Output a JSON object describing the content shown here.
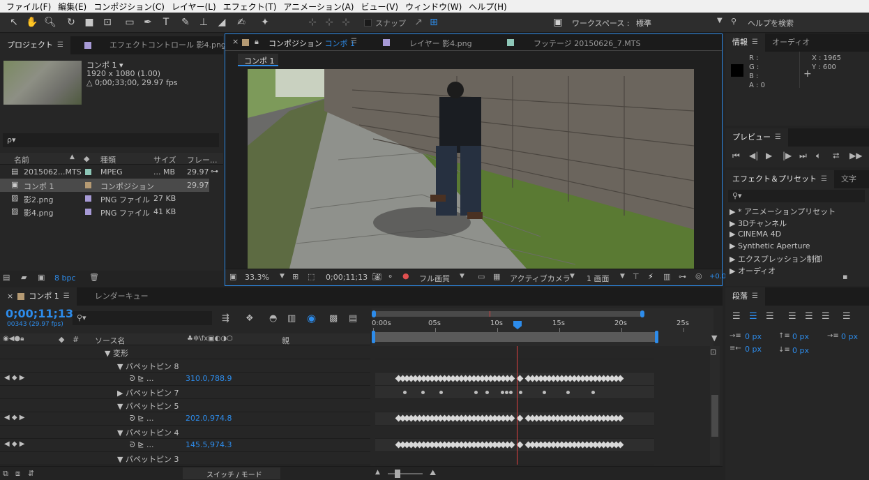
{
  "menu": [
    "ファイル(F)",
    "編集(E)",
    "コンポジション(C)",
    "レイヤー(L)",
    "エフェクト(T)",
    "アニメーション(A)",
    "ビュー(V)",
    "ウィンドウ(W)",
    "ヘルプ(H)"
  ],
  "toolbar": {
    "snap": "スナップ",
    "workspace_label": "ワークスペース :",
    "workspace_value": "標準",
    "help_placeholder": "ヘルプを検索"
  },
  "project": {
    "tab": "プロジェクト",
    "tab2": "エフェクトコントロール 影4.png",
    "comp_name": "コンポ 1 ▾",
    "res": "1920 x 1080 (1.00)",
    "dur": "△ 0;00;33;00, 29.97 fps",
    "search": "ρ▾",
    "cols": [
      "名前",
      "種類",
      "サイズ",
      "フレー..."
    ],
    "items": [
      {
        "name": "2015062...MTS",
        "type": "MPEG",
        "size": "... MB",
        "fps": "29.97",
        "color": "#8ec7b8"
      },
      {
        "name": "コンポ 1",
        "type": "コンポジション",
        "size": "",
        "fps": "29.97",
        "color": "#b59a73"
      },
      {
        "name": "影2.png",
        "type": "PNG ファイル",
        "size": "27 KB",
        "fps": "",
        "color": "#a79ad6"
      },
      {
        "name": "影4.png",
        "type": "PNG ファイル",
        "size": "41 KB",
        "fps": "",
        "color": "#a79ad6"
      }
    ],
    "bpc": "8 bpc"
  },
  "comp": {
    "tab1": "コンポジション",
    "tab1b": "コンポ 1",
    "tab2": "レイヤー 影4.png",
    "tab3": "フッテージ 20150626_7.MTS",
    "sub": "コンポ 1",
    "zoom": "33.3%",
    "time": "0;00;11;13",
    "quality": "フル画質",
    "camera": "アクティブカメラ",
    "view": "1 画面",
    "plus": "+0.0"
  },
  "info": {
    "tab": "情報",
    "tab2": "オーディオ",
    "r": "R :",
    "g": "G :",
    "b": "B :",
    "a": "A : 0",
    "x": "X : 1965",
    "y": "Y : 600"
  },
  "preview": {
    "tab": "プレビュー"
  },
  "effects": {
    "tab": "エフェクト＆プリセット",
    "tab2": "文字",
    "items": [
      "▶ * アニメーションプリセット",
      "▶ 3Dチャンネル",
      "▶ CINEMA 4D",
      "▶ Synthetic Aperture",
      "▶ エクスプレッション制御",
      "▶ オーディオ"
    ]
  },
  "timeline": {
    "tab": "コンポ 1",
    "tab2": "レンダーキュー",
    "timecode": "0;00;11;13",
    "frames": "00343 (29.97 fps)",
    "col_source": "ソース名",
    "col_parent": "親",
    "col_hash": "#",
    "ruler": [
      "0:00s",
      "05s",
      "10s",
      "15s",
      "20s",
      "25s"
    ],
    "rows": [
      {
        "indent": 150,
        "label": "▼  変形",
        "value": "",
        "kf": false
      },
      {
        "indent": 168,
        "label": "▼  パペットピン 8",
        "value": "",
        "kf": false
      },
      {
        "indent": 186,
        "label": "ᘒ ⊵  ...",
        "value": "310.0,788.9",
        "kf": true
      },
      {
        "indent": 168,
        "label": "▶  パペットピン 7",
        "value": "",
        "kf": false
      },
      {
        "indent": 168,
        "label": "▼  パペットピン 5",
        "value": "",
        "kf": false
      },
      {
        "indent": 186,
        "label": "ᘒ ⊵  ...",
        "value": "202.0,974.8",
        "kf": true
      },
      {
        "indent": 168,
        "label": "▼  パペットピン 4",
        "value": "",
        "kf": false
      },
      {
        "indent": 186,
        "label": "ᘒ ⊵  ...",
        "value": "145.5,974.3",
        "kf": true
      },
      {
        "indent": 168,
        "label": "▼  パペットピン 3",
        "value": "",
        "kf": false
      }
    ],
    "switch_mode": "スイッチ / モード"
  },
  "paragraph": {
    "tab": "段落",
    "v1": "0 px",
    "v2": "0 px",
    "v3": "0 px",
    "v4": "0 px",
    "v5": "0 px"
  }
}
